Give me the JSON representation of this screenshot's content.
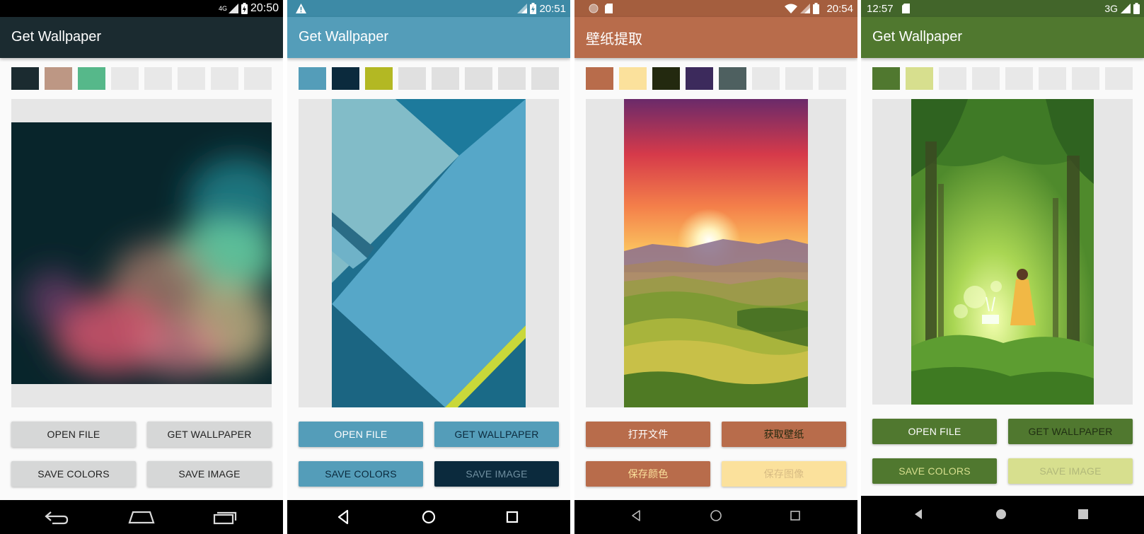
{
  "screens": [
    {
      "status_time": "20:50",
      "network_label": "4G",
      "app_title": "Get Wallpaper",
      "colors": {
        "status": "#000000",
        "app_bar": "#1b2b30"
      },
      "palette": [
        "#1b2b30",
        "#bd9784",
        "#56b88a"
      ],
      "buttons": {
        "open_file": "OPEN FILE",
        "get_wallpaper": "GET WALLPAPER",
        "save_colors": "SAVE COLORS",
        "save_image": "SAVE IMAGE"
      },
      "wallpaper": "blurred-aurora-abstract"
    },
    {
      "status_time": "20:51",
      "app_title": "Get Wallpaper",
      "colors": {
        "status": "#3d8aa6",
        "app_bar": "#549db9"
      },
      "palette": [
        "#549db9",
        "#0b2a3d",
        "#b3b823"
      ],
      "buttons": {
        "open_file": "OPEN FILE",
        "get_wallpaper": "GET WALLPAPER",
        "save_colors": "SAVE COLORS",
        "save_image": "SAVE IMAGE"
      },
      "wallpaper": "material-blue-layers"
    },
    {
      "status_time": "20:54",
      "app_title": "壁纸提取",
      "colors": {
        "status": "#a45e3e",
        "app_bar": "#b86c4b"
      },
      "palette": [
        "#b86c4b",
        "#fbe19c",
        "#23290f",
        "#3c2a5c",
        "#4e6060"
      ],
      "buttons": {
        "open_file": "打开文件",
        "get_wallpaper": "获取壁纸",
        "save_colors": "保存颜色",
        "save_image": "保存图像"
      },
      "wallpaper": "mountain-sunrise"
    },
    {
      "status_time": "12:57",
      "network_label": "3G",
      "app_title": "Get Wallpaper",
      "colors": {
        "status": "#42652a",
        "app_bar": "#50782f"
      },
      "palette": [
        "#50782f",
        "#d7df8e"
      ],
      "buttons": {
        "open_file": "OPEN FILE",
        "get_wallpaper": "GET WALLPAPER",
        "save_colors": "SAVE COLORS",
        "save_image": "SAVE IMAGE"
      },
      "wallpaper": "forest-girl-and-deer"
    }
  ]
}
